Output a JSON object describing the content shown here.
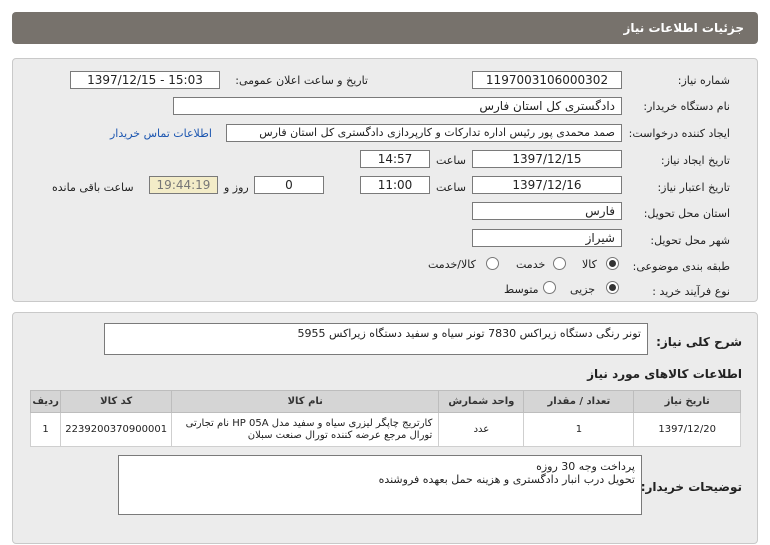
{
  "header": {
    "title": "جزئیات اطلاعات نیاز"
  },
  "form": {
    "need_number_label": "شماره نیاز:",
    "need_number": "1197003106000302",
    "announce_label": "تاریخ و ساعت اعلان عمومی:",
    "announce_value": "1397/12/15 - 15:03",
    "buyer_org_label": "نام دستگاه خریدار:",
    "buyer_org": "دادگستری کل استان فارس",
    "requester_label": "ایجاد کننده درخواست:",
    "requester": "صمد محمدی پور رئیس اداره تدارکات و کارپردازی دادگستری کل استان فارس",
    "contact_link": "اطلاعات تماس خریدار",
    "created_label": "تاریخ ایجاد نیاز:",
    "created_date": "1397/12/15",
    "time_label": "ساعت",
    "created_time": "14:57",
    "validity_label": "تاریخ اعتبار نیاز:",
    "validity_date": "1397/12/16",
    "validity_time": "11:00",
    "days_value": "0",
    "days_label": "روز و",
    "remaining_value": "19:44:19",
    "remaining_label": "ساعت باقی مانده",
    "province_label": "استان محل تحویل:",
    "province": "فارس",
    "city_label": "شهر محل تحویل:",
    "city": "شیراز",
    "category_label": "طبقه بندی موضوعی:",
    "category_options": [
      "کالا",
      "خدمت",
      "کالا/خدمت"
    ],
    "category_selected": "کالا",
    "process_label": "نوع فرآیند خرید :",
    "process_options": [
      "جزیی",
      "متوسط"
    ],
    "process_selected": "جزیی"
  },
  "summary": {
    "label": "شرح کلی نیاز:",
    "text": "تونر رنگی دستگاه زیراکس 7830 تونر سیاه و سفید دستگاه زیراکس 5955"
  },
  "goods": {
    "title": "اطلاعات کالاهای مورد نیاز",
    "columns": [
      "ردیف",
      "کد کالا",
      "نام کالا",
      "واحد شمارش",
      "تعداد / مقدار",
      "تاریخ نیاز"
    ],
    "rows": [
      {
        "row": "1",
        "code": "2239200370900001",
        "name_line1": "کارتریج چاپگر لیزری سیاه و سفید مدل HP 05A نام تجارتی",
        "name_line2": "تورال مرجع عرضه کننده تورال صنعت سبلان",
        "unit": "عدد",
        "qty": "1",
        "date": "1397/12/20"
      }
    ]
  },
  "buyer_notes": {
    "label": "توضیحات خریدار:",
    "line1": "پرداخت وجه 30 روزه",
    "line2": "تحویل درب انبار دادگستری و هزینه حمل بعهده فروشنده"
  }
}
